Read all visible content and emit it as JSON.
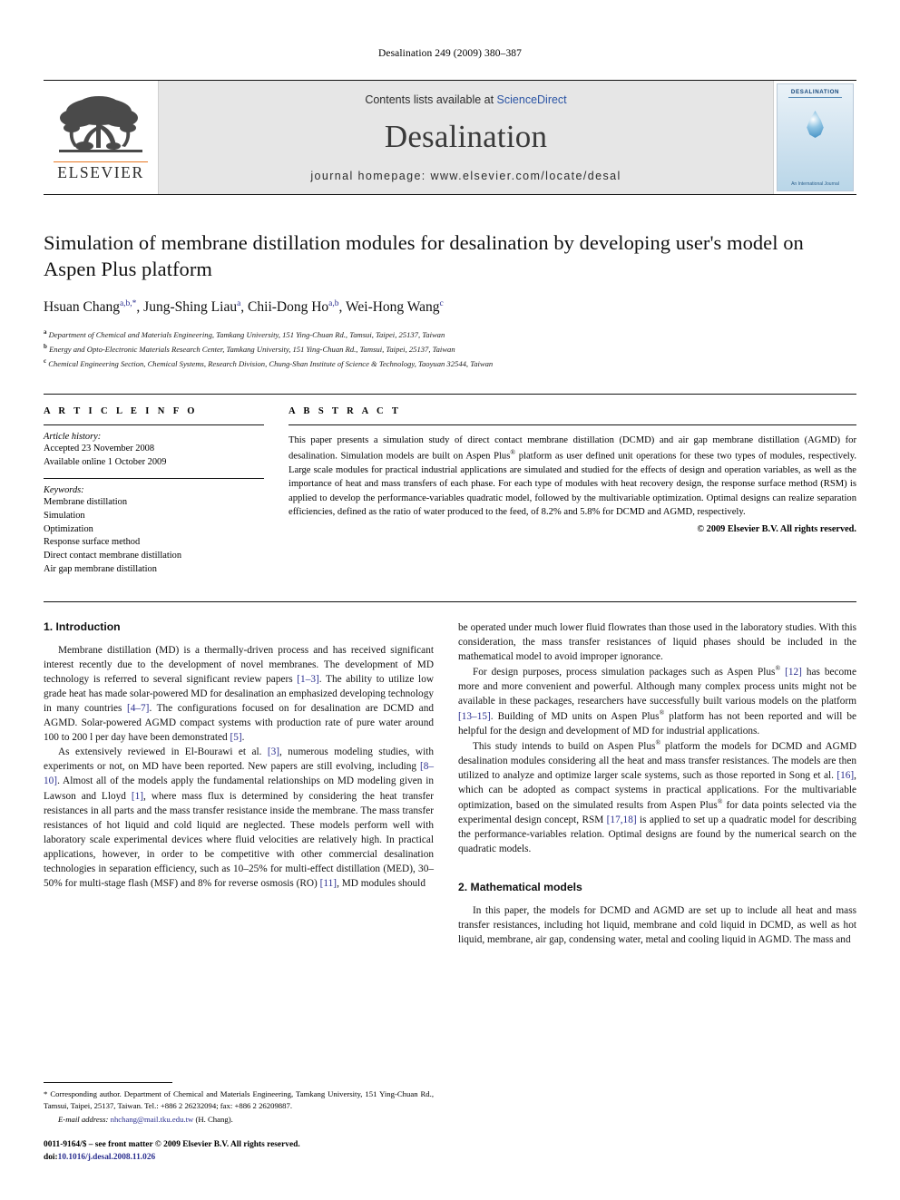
{
  "running_head": "Desalination 249 (2009) 380–387",
  "masthead": {
    "publisher": "ELSEVIER",
    "contents_prefix": "Contents lists available at ",
    "contents_link": "ScienceDirect",
    "journal_name": "Desalination",
    "homepage": "journal homepage: www.elsevier.com/locate/desal",
    "cover_title": "DESALINATION",
    "cover_footer": "An International Journal"
  },
  "article": {
    "title": "Simulation of membrane distillation modules for desalination by developing user's model on Aspen Plus platform",
    "authors": [
      {
        "name": "Hsuan Chang",
        "marks": "a,b,*"
      },
      {
        "name": "Jung-Shing Liau",
        "marks": "a"
      },
      {
        "name": "Chii-Dong Ho",
        "marks": "a,b"
      },
      {
        "name": "Wei-Hong Wang",
        "marks": "c"
      }
    ],
    "affiliations": [
      {
        "mark": "a",
        "text": "Department of Chemical and Materials Engineering, Tamkang University, 151 Ying-Chuan Rd., Tamsui, Taipei, 25137, Taiwan"
      },
      {
        "mark": "b",
        "text": "Energy and Opto-Electronic Materials Research Center, Tamkang University, 151 Ying-Chuan Rd., Tamsui, Taipei, 25137, Taiwan"
      },
      {
        "mark": "c",
        "text": "Chemical Engineering Section, Chemical Systems, Research Division, Chung-Shan Institute of Science & Technology, Taoyuan 32544, Taiwan"
      }
    ]
  },
  "article_info": {
    "heading": "A R T I C L E   I N F O",
    "history_label": "Article history:",
    "history_lines": [
      "Accepted 23 November 2008",
      "Available online 1 October 2009"
    ],
    "keywords_label": "Keywords:",
    "keywords": [
      "Membrane distillation",
      "Simulation",
      "Optimization",
      "Response surface method",
      "Direct contact membrane distillation",
      "Air gap membrane distillation"
    ]
  },
  "abstract": {
    "heading": "A B S T R A C T",
    "text": "This paper presents a simulation study of direct contact membrane distillation (DCMD) and air gap membrane distillation (AGMD) for desalination. Simulation models are built on Aspen Plus® platform as user defined unit operations for these two types of modules, respectively. Large scale modules for practical industrial applications are simulated and studied for the effects of design and operation variables, as well as the importance of heat and mass transfers of each phase. For each type of modules with heat recovery design, the response surface method (RSM) is applied to develop the performance-variables quadratic model, followed by the multivariable optimization. Optimal designs can realize separation efficiencies, defined as the ratio of water produced to the feed, of 8.2% and 5.8% for DCMD and AGMD, respectively.",
    "copyright": "© 2009 Elsevier B.V. All rights reserved."
  },
  "sections": {
    "introduction_heading": "1. Introduction",
    "mathematical_models_heading": "2. Mathematical models",
    "intro_p1": "Membrane distillation (MD) is a thermally-driven process and has received significant interest recently due to the development of novel membranes. The development of MD technology is referred to several significant review papers [1–3]. The ability to utilize low grade heat has made solar-powered MD for desalination an emphasized developing technology in many countries [4–7]. The configurations focused on for desalination are DCMD and AGMD. Solar-powered AGMD compact systems with production rate of pure water around 100 to 200 l per day have been demonstrated [5].",
    "intro_p2": "As extensively reviewed in El-Bourawi et al. [3], numerous modeling studies, with experiments or not, on MD have been reported. New papers are still evolving, including [8–10]. Almost all of the models apply the fundamental relationships on MD modeling given in Lawson and Lloyd [1], where mass flux is determined by considering the heat transfer resistances in all parts and the mass transfer resistance inside the membrane. The mass transfer resistances of hot liquid and cold liquid are neglected. These models perform well with laboratory scale experimental devices where fluid velocities are relatively high. In practical applications, however, in order to be competitive with other commercial desalination technologies in separation efficiency, such as 10–25% for multi-effect distillation (MED), 30–50% for multi-stage flash (MSF) and 8% for reverse osmosis (RO) [11], MD modules should",
    "intro_p2_cont": "be operated under much lower fluid flowrates than those used in the laboratory studies. With this consideration, the mass transfer resistances of liquid phases should be included in the mathematical model to avoid improper ignorance.",
    "intro_p3": "For design purposes, process simulation packages such as Aspen Plus® [12] has become more and more convenient and powerful. Although many complex process units might not be available in these packages, researchers have successfully built various models on the platform [13–15]. Building of MD units on Aspen Plus® platform has not been reported and will be helpful for the design and development of MD for industrial applications.",
    "intro_p4": "This study intends to build on Aspen Plus® platform the models for DCMD and AGMD desalination modules considering all the heat and mass transfer resistances. The models are then utilized to analyze and optimize larger scale systems, such as those reported in Song et al. [16], which can be adopted as compact systems in practical applications. For the multivariable optimization, based on the simulated results from Aspen Plus® for data points selected via the experimental design concept, RSM [17,18] is applied to set up a quadratic model for describing the performance-variables relation. Optimal designs are found by the numerical search on the quadratic models.",
    "math_p1": "In this paper, the models for DCMD and AGMD are set up to include all heat and mass transfer resistances, including hot liquid, membrane and cold liquid in DCMD, as well as hot liquid, membrane, air gap, condensing water, metal and cooling liquid in AGMD. The mass and"
  },
  "footnote": {
    "corresponding": "* Corresponding author. Department of Chemical and Materials Engineering, Tamkang University, 151 Ying-Chuan Rd., Tamsui, Taipei, 25137, Taiwan. Tel.: +886 2 26232094; fax: +886 2 26209887.",
    "email_label": "E-mail address:",
    "email": "nhchang@mail.tku.edu.tw",
    "email_suffix": "(H. Chang).",
    "issn_line": "0011-9164/$ – see front matter © 2009 Elsevier B.V. All rights reserved.",
    "doi_label": "doi:",
    "doi": "10.1016/j.desal.2008.11.026"
  },
  "colors": {
    "link": "#2b2f8f",
    "sciencedirect": "#2b54a4",
    "elsevier_orange": "#E87722",
    "masthead_bg": "#e6e6e6"
  }
}
